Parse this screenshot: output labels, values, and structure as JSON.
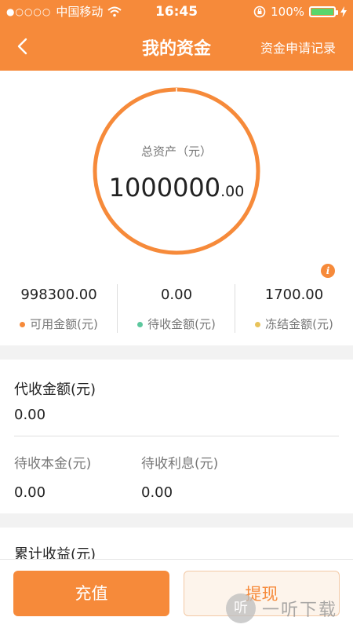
{
  "status_bar": {
    "carrier": "中国移动",
    "time": "16:45",
    "battery": "100%"
  },
  "nav": {
    "title": "我的资金",
    "right_link": "资金申请记录"
  },
  "summary": {
    "total_label": "总资产（元）",
    "total_int": "1000000",
    "total_dec": ".00"
  },
  "stats": [
    {
      "value": "998300.00",
      "label": "可用金额(元)",
      "color": "#f68a3a"
    },
    {
      "value": "0.00",
      "label": "待收金额(元)",
      "color": "#5cc79d"
    },
    {
      "value": "1700.00",
      "label": "冻结金额(元)",
      "color": "#e8c35a"
    }
  ],
  "collection": {
    "title": "代收金额(元)",
    "value": "0.00",
    "principal_label": "待收本金(元)",
    "principal_value": "0.00",
    "interest_label": "待收利息(元)",
    "interest_value": "0.00"
  },
  "cumulative": {
    "title": "累计收益(元)"
  },
  "actions": {
    "recharge": "充值",
    "withdraw": "提现"
  },
  "watermark": {
    "icon_text": "听",
    "text": "一听下载"
  },
  "colors": {
    "accent": "#f68a3a"
  }
}
